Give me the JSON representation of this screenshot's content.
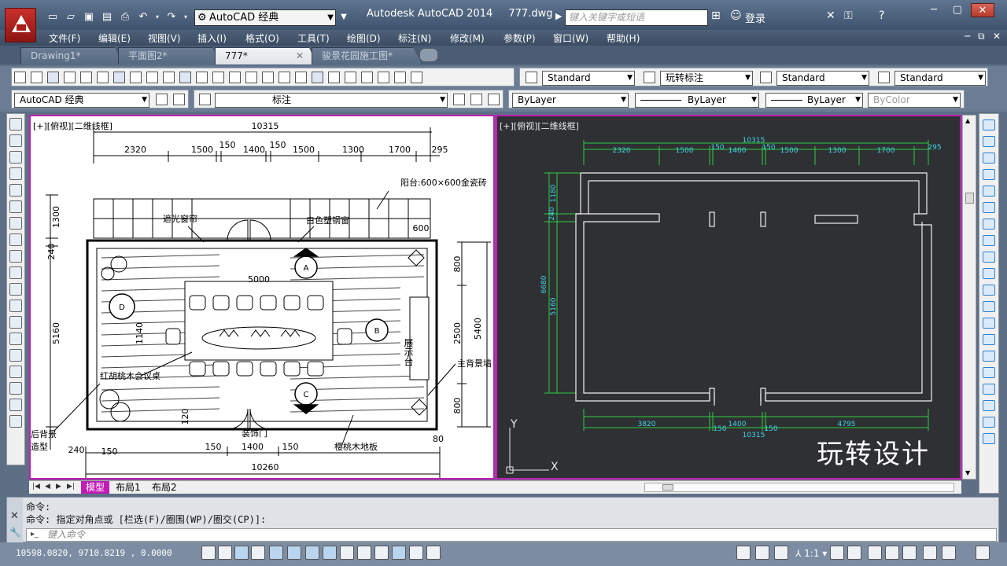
{
  "app": {
    "workspace": "AutoCAD 经典",
    "product": "Autodesk AutoCAD 2014",
    "file": "777.dwg",
    "search_placeholder": "键入关键字或短语",
    "login": "登录"
  },
  "menu": [
    "文件(F)",
    "编辑(E)",
    "视图(V)",
    "插入(I)",
    "格式(O)",
    "工具(T)",
    "绘图(D)",
    "标注(N)",
    "修改(M)",
    "参数(P)",
    "窗口(W)",
    "帮助(H)"
  ],
  "tabs": [
    {
      "label": "Drawing1*"
    },
    {
      "label": "平面图2*"
    },
    {
      "label": "777*"
    },
    {
      "label": "骏景花园施工图*"
    }
  ],
  "toolbar": {
    "text_style": "Standard",
    "dim_style": "玩转标注",
    "table_style": "Standard",
    "mleader_style": "Standard",
    "workspace": "AutoCAD 经典",
    "layer": "标注",
    "color": "ByLayer",
    "linetype": "ByLayer",
    "lineweight": "ByLayer",
    "plotstyle": "ByColor"
  },
  "viewports": {
    "left_label": "[+][俯视][二维线框]",
    "right_label": "[+][俯视][二维线框]"
  },
  "drawing_left": {
    "top_total": "10315",
    "top_dims": [
      "2320",
      "1500",
      "150",
      "1400",
      "150",
      "1500",
      "1300",
      "1700",
      "295"
    ],
    "left_dims": [
      "1300",
      "240",
      "5160"
    ],
    "right_dims": [
      "600",
      "800",
      "2500",
      "5400",
      "800"
    ],
    "bottom_dims": [
      "240",
      "150",
      "150",
      "1400",
      "150",
      "80"
    ],
    "bottom_total": "10260",
    "inner_dims": [
      "5000",
      "1140",
      "120"
    ],
    "labels": {
      "balcony": "阳台:600×600金瓷砖",
      "curtain": "遮光窗帘",
      "window": "白色塑钢窗",
      "table": "红胡桃木会议桌",
      "display": "展示台",
      "main_bg": "主背景墙",
      "door": "装饰门",
      "floor": "樱桃木地板",
      "side_bg_1": "后背景",
      "side_bg_2": "造型"
    },
    "markers": [
      "A",
      "B",
      "C",
      "D"
    ]
  },
  "drawing_right": {
    "top_total": "10315",
    "top_dims": [
      "2320",
      "1500",
      "150",
      "1400",
      "150",
      "1500",
      "1300",
      "1700",
      "295"
    ],
    "left_dims": [
      "1180",
      "240",
      "6680",
      "5160"
    ],
    "bottom_dims": [
      "3820",
      "150",
      "1400",
      "150",
      "4795"
    ],
    "bottom_total": "10315",
    "ucs_y": "Y",
    "ucs_x": "X"
  },
  "layout_tabs": [
    "模型",
    "布局1",
    "布局2"
  ],
  "command": {
    "line1": "命令:",
    "line2": "命令: 指定对角点或 [栏选(F)/圈围(WP)/圈交(CP)]:",
    "placeholder": "键入命令"
  },
  "status": {
    "coords": "10598.0820, 9710.8219 , 0.0000",
    "scale": "1:1"
  },
  "watermark": "玩转设计",
  "colors": {
    "viewport_border": "#c21cb5",
    "dim_green": "#2ecc40",
    "dim_cyan": "#3fd3e8",
    "model_bg": "#2f3033"
  }
}
